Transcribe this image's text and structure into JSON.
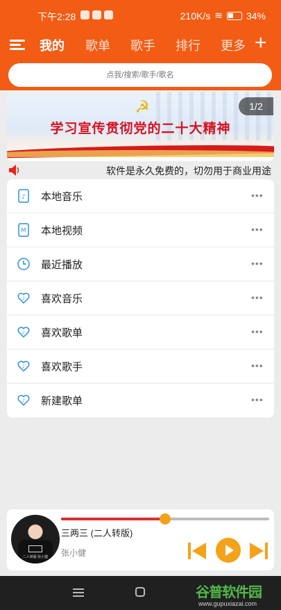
{
  "status_bar": {
    "time": "下午2:28",
    "network_speed": "210K/s",
    "battery": "34%"
  },
  "nav": {
    "tabs": [
      "我的",
      "歌单",
      "歌手",
      "排行",
      "更多"
    ],
    "active_tab": "我的",
    "plus": "+"
  },
  "search": {
    "placeholder": "点我/搜索/歌手/歌名"
  },
  "banner": {
    "slogan": "学习宣传贯彻党的二十大精神",
    "counter": "1/2"
  },
  "marquee": {
    "text": "软件是永久免费的，切勿用于商业用途"
  },
  "menu": [
    {
      "label": "本地音乐",
      "icon": "local-music-icon",
      "more": "•••"
    },
    {
      "label": "本地视频",
      "icon": "local-video-icon",
      "more": "•••"
    },
    {
      "label": "最近播放",
      "icon": "clock-icon",
      "more": "•••"
    },
    {
      "label": "喜欢音乐",
      "icon": "heart-music-icon",
      "more": "•••"
    },
    {
      "label": "喜欢歌单",
      "icon": "heart-music-icon",
      "more": "•••"
    },
    {
      "label": "喜欢歌手",
      "icon": "heart-music-icon",
      "more": "•••"
    },
    {
      "label": "新建歌单",
      "icon": "heart-music-icon",
      "more": "•••"
    }
  ],
  "player": {
    "song_title": "三两三 (二人转版)",
    "artist": "张小健",
    "album_caption": "二人转版 张小健",
    "progress": 0.5
  },
  "watermark": {
    "brand": "谷普软件园",
    "url": "www.gupuxiazai.com"
  },
  "colors": {
    "primary": "#f25c14",
    "accent": "#f4a21a",
    "icon_blue": "#2f8fd8",
    "progress_red": "#d82f2f"
  }
}
